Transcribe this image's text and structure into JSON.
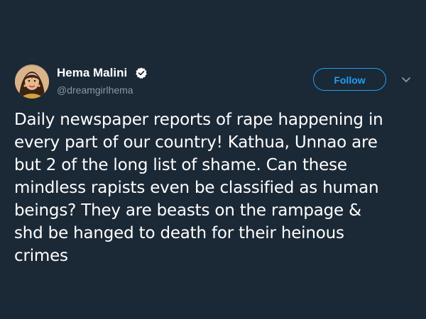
{
  "author": {
    "display_name": "Hema Malini",
    "handle": "@dreamgirlhema",
    "verified": true,
    "avatar_icon": "profile-photo"
  },
  "actions": {
    "follow_label": "Follow",
    "menu_icon": "chevron-down-icon"
  },
  "tweet": {
    "lines": [
      "Daily newspaper reports of rape happening in",
      "every part of our country! Kathua, Unnao are",
      "but 2 of the long list of shame. Can these",
      "mindless rapists even be classified as human",
      "beings? They are beasts on the rampage &",
      "shd be hanged to death for their heinous",
      "crimes"
    ]
  },
  "colors": {
    "background": "#1b2836",
    "accent": "#1da1f2",
    "secondary_text": "#8899a6",
    "primary_text": "#ffffff"
  }
}
